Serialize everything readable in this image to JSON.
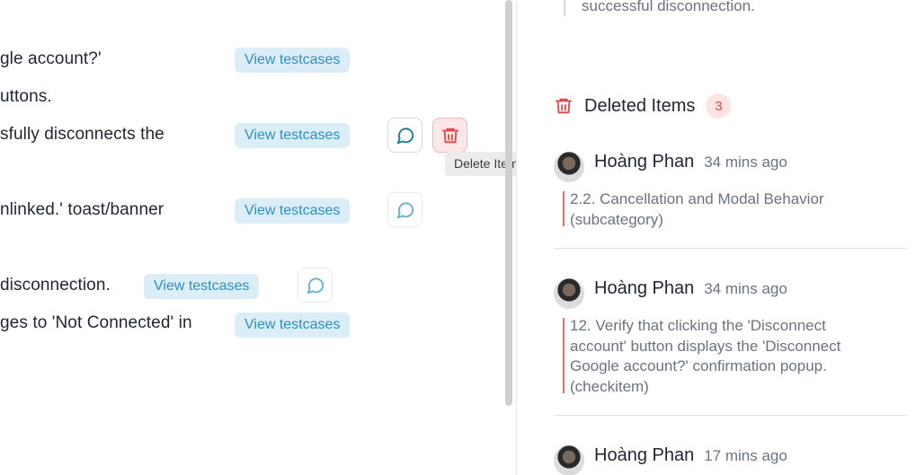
{
  "left": {
    "rows": [
      {
        "text": "gle account?'",
        "view_label": "View testcases"
      },
      {
        "text": "uttons."
      },
      {
        "text": "sfully disconnects the",
        "view_label": "View testcases"
      },
      {
        "text": "nlinked.' toast/banner",
        "view_label": "View testcases"
      },
      {
        "text": "disconnection.",
        "view_label": "View testcases"
      },
      {
        "text": "ges to 'Not Connected' in",
        "view_label": "View testcases"
      }
    ],
    "tooltip": "Delete Item"
  },
  "right": {
    "previous_text": "successful disconnection.",
    "deleted_header": {
      "title": "Deleted Items",
      "count": "3"
    },
    "entries": [
      {
        "name": "Hoàng Phan",
        "time": "34 mins ago",
        "lines": [
          "2.2. Cancellation and Modal Behavior",
          "(subcategory)"
        ]
      },
      {
        "name": "Hoàng Phan",
        "time": "34 mins ago",
        "lines": [
          "12. Verify that clicking the 'Disconnect",
          "account' button displays the 'Disconnect",
          "Google account?' confirmation popup.",
          "(checkitem)"
        ]
      },
      {
        "name": "Hoàng Phan",
        "time": "17 mins ago",
        "lines": []
      }
    ]
  },
  "colors": {
    "accent": "#2f8ec2",
    "danger": "#e04848",
    "badge_bg": "#fde4e4"
  }
}
